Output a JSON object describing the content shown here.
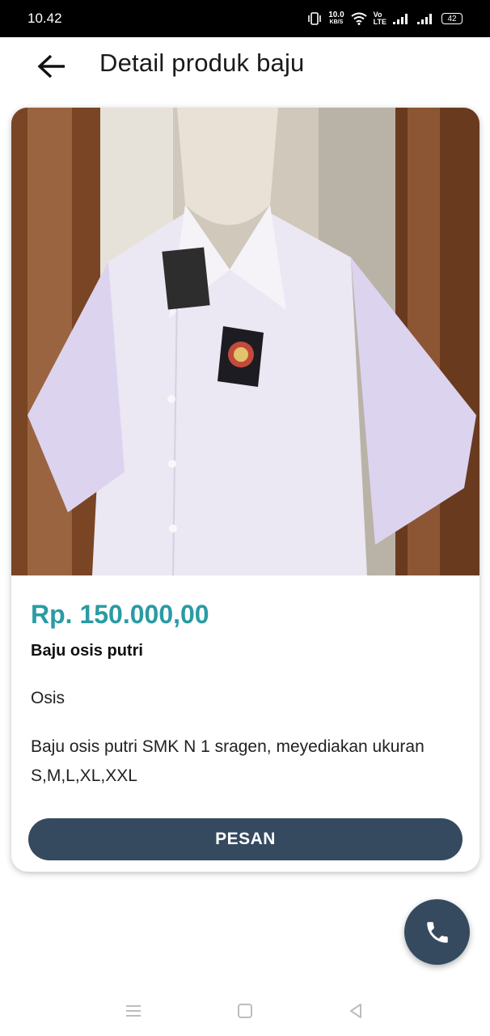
{
  "status_bar": {
    "time": "10.42",
    "net_speed_value": "10.0",
    "net_speed_unit": "KB/S",
    "volte_top": "Vo",
    "volte_bottom": "LTE",
    "battery": "42"
  },
  "app_bar": {
    "title": "Detail produk baju",
    "back_icon": "arrow-left-icon"
  },
  "product": {
    "image_icon": "product-photo",
    "price": "Rp. 150.000,00",
    "name": "Baju osis putri",
    "category": "Osis",
    "description": "Baju osis putri SMK N 1 sragen, meyediakan ukuran S,M,L,XL,XXL",
    "order_button": "PESAN"
  },
  "fab": {
    "icon": "phone-icon"
  },
  "nav": {
    "menu_icon": "menu-icon",
    "home_icon": "square-icon",
    "back_icon": "triangle-back-icon"
  },
  "colors": {
    "price": "#2a9ba3",
    "primary_button": "#354a5f",
    "status_bar": "#000000"
  }
}
